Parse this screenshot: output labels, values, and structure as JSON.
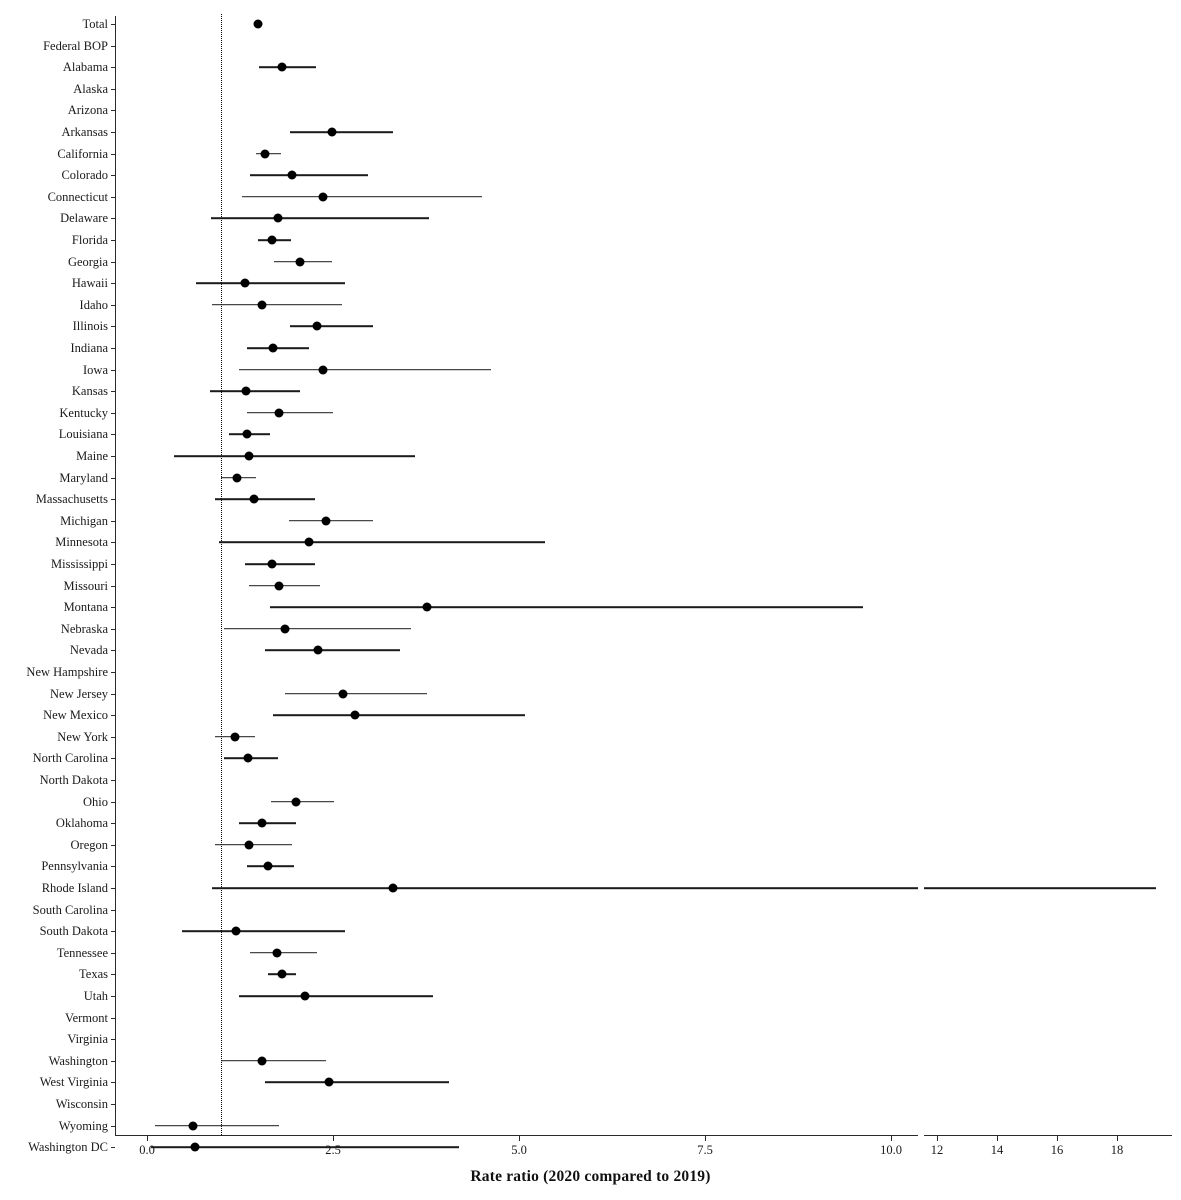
{
  "chart_data": {
    "type": "scatter",
    "subtype": "forest-plot",
    "title": "",
    "xlabel": "Rate ratio (2020 compared to 2019)",
    "ylabel": "",
    "reference_line": 1.0,
    "grid": false,
    "legend": "none",
    "axis_break": true,
    "panels": [
      {
        "name": "main",
        "xlim": [
          -0.35,
          10.4
        ],
        "ticks": [
          0.0,
          2.5,
          5.0,
          7.5,
          10.0
        ],
        "tick_labels": [
          "0.0",
          "2.5",
          "5.0",
          "7.5",
          "10.0"
        ]
      },
      {
        "name": "extended",
        "xlim": [
          11.2,
          19.4
        ],
        "ticks": [
          12,
          14,
          16,
          18
        ],
        "tick_labels": [
          "12",
          "14",
          "16",
          "18"
        ]
      }
    ],
    "categories": [
      "Total",
      "Federal BOP",
      "Alabama",
      "Alaska",
      "Arizona",
      "Arkansas",
      "California",
      "Colorado",
      "Connecticut",
      "Delaware",
      "Florida",
      "Georgia",
      "Hawaii",
      "Idaho",
      "Illinois",
      "Indiana",
      "Iowa",
      "Kansas",
      "Kentucky",
      "Louisiana",
      "Maine",
      "Maryland",
      "Massachusetts",
      "Michigan",
      "Minnesota",
      "Mississippi",
      "Missouri",
      "Montana",
      "Nebraska",
      "Nevada",
      "New Hampshire",
      "New Jersey",
      "New Mexico",
      "New York",
      "North Carolina",
      "North Dakota",
      "Ohio",
      "Oklahoma",
      "Oregon",
      "Pennsylvania",
      "Rhode Island",
      "South Carolina",
      "South Dakota",
      "Tennessee",
      "Texas",
      "Utah",
      "Vermont",
      "Virginia",
      "Washington",
      "West Virginia",
      "Wisconsin",
      "Wyoming",
      "Washington DC"
    ],
    "series_name": "Rate ratio with 95% CI",
    "points": [
      {
        "label": "Total",
        "estimate": 1.49,
        "ci_low": 1.46,
        "ci_high": 1.53
      },
      {
        "label": "Federal BOP",
        "estimate": null,
        "ci_low": null,
        "ci_high": null
      },
      {
        "label": "Alabama",
        "estimate": 1.82,
        "ci_low": 1.51,
        "ci_high": 2.27
      },
      {
        "label": "Alaska",
        "estimate": null,
        "ci_low": null,
        "ci_high": null
      },
      {
        "label": "Arizona",
        "estimate": null,
        "ci_low": null,
        "ci_high": null
      },
      {
        "label": "Arkansas",
        "estimate": 2.48,
        "ci_low": 1.92,
        "ci_high": 3.31
      },
      {
        "label": "California",
        "estimate": 1.59,
        "ci_low": 1.47,
        "ci_high": 1.8
      },
      {
        "label": "Colorado",
        "estimate": 1.95,
        "ci_low": 1.39,
        "ci_high": 2.97
      },
      {
        "label": "Connecticut",
        "estimate": 2.37,
        "ci_low": 1.28,
        "ci_high": 4.5
      },
      {
        "label": "Delaware",
        "estimate": 1.76,
        "ci_low": 0.86,
        "ci_high": 3.79
      },
      {
        "label": "Florida",
        "estimate": 1.68,
        "ci_low": 1.49,
        "ci_high": 1.93
      },
      {
        "label": "Georgia",
        "estimate": 2.05,
        "ci_low": 1.71,
        "ci_high": 2.49
      },
      {
        "label": "Hawaii",
        "estimate": 1.32,
        "ci_low": 0.66,
        "ci_high": 2.66
      },
      {
        "label": "Idaho",
        "estimate": 1.55,
        "ci_low": 0.88,
        "ci_high": 2.62
      },
      {
        "label": "Illinois",
        "estimate": 2.29,
        "ci_low": 1.92,
        "ci_high": 3.04
      },
      {
        "label": "Indiana",
        "estimate": 1.7,
        "ci_low": 1.34,
        "ci_high": 2.18
      },
      {
        "label": "Iowa",
        "estimate": 2.36,
        "ci_low": 1.24,
        "ci_high": 4.63
      },
      {
        "label": "Kansas",
        "estimate": 1.33,
        "ci_low": 0.85,
        "ci_high": 2.05
      },
      {
        "label": "Kentucky",
        "estimate": 1.78,
        "ci_low": 1.35,
        "ci_high": 2.5
      },
      {
        "label": "Louisiana",
        "estimate": 1.35,
        "ci_low": 1.1,
        "ci_high": 1.65
      },
      {
        "label": "Maine",
        "estimate": 1.37,
        "ci_low": 0.36,
        "ci_high": 3.6
      },
      {
        "label": "Maryland",
        "estimate": 1.21,
        "ci_low": 0.99,
        "ci_high": 1.47
      },
      {
        "label": "Massachusetts",
        "estimate": 1.44,
        "ci_low": 0.91,
        "ci_high": 2.26
      },
      {
        "label": "Michigan",
        "estimate": 2.41,
        "ci_low": 1.91,
        "ci_high": 3.04
      },
      {
        "label": "Minnesota",
        "estimate": 2.18,
        "ci_low": 0.97,
        "ci_high": 5.35
      },
      {
        "label": "Mississippi",
        "estimate": 1.68,
        "ci_low": 1.32,
        "ci_high": 2.26
      },
      {
        "label": "Missouri",
        "estimate": 1.77,
        "ci_low": 1.37,
        "ci_high": 2.33
      },
      {
        "label": "Montana",
        "estimate": 3.76,
        "ci_low": 1.65,
        "ci_high": 9.62
      },
      {
        "label": "Nebraska",
        "estimate": 1.85,
        "ci_low": 1.03,
        "ci_high": 3.55
      },
      {
        "label": "Nevada",
        "estimate": 2.3,
        "ci_low": 1.59,
        "ci_high": 3.4
      },
      {
        "label": "New Hampshire",
        "estimate": null,
        "ci_low": null,
        "ci_high": null
      },
      {
        "label": "New Jersey",
        "estimate": 2.63,
        "ci_low": 1.86,
        "ci_high": 3.77
      },
      {
        "label": "New Mexico",
        "estimate": 2.8,
        "ci_low": 1.7,
        "ci_high": 5.08
      },
      {
        "label": "New York",
        "estimate": 1.18,
        "ci_low": 0.92,
        "ci_high": 1.45
      },
      {
        "label": "North Carolina",
        "estimate": 1.36,
        "ci_low": 1.04,
        "ci_high": 1.76
      },
      {
        "label": "North Dakota",
        "estimate": null,
        "ci_low": null,
        "ci_high": null
      },
      {
        "label": "Ohio",
        "estimate": 2.0,
        "ci_low": 1.66,
        "ci_high": 2.52
      },
      {
        "label": "Oklahoma",
        "estimate": 1.54,
        "ci_low": 1.24,
        "ci_high": 2.0
      },
      {
        "label": "Oregon",
        "estimate": 1.37,
        "ci_low": 0.92,
        "ci_high": 1.95
      },
      {
        "label": "Pennsylvania",
        "estimate": 1.62,
        "ci_low": 1.35,
        "ci_high": 1.97
      },
      {
        "label": "Rhode Island",
        "estimate": 3.3,
        "ci_low": 0.88,
        "ci_high": 19.3
      },
      {
        "label": "South Carolina",
        "estimate": null,
        "ci_low": null,
        "ci_high": null
      },
      {
        "label": "South Dakota",
        "estimate": 1.2,
        "ci_low": 0.47,
        "ci_high": 2.66
      },
      {
        "label": "Tennessee",
        "estimate": 1.75,
        "ci_low": 1.38,
        "ci_high": 2.28
      },
      {
        "label": "Texas",
        "estimate": 1.81,
        "ci_low": 1.63,
        "ci_high": 2.0
      },
      {
        "label": "Utah",
        "estimate": 2.13,
        "ci_low": 1.23,
        "ci_high": 3.85
      },
      {
        "label": "Vermont",
        "estimate": null,
        "ci_low": null,
        "ci_high": null
      },
      {
        "label": "Virginia",
        "estimate": null,
        "ci_low": null,
        "ci_high": null
      },
      {
        "label": "Washington",
        "estimate": 1.55,
        "ci_low": 1.0,
        "ci_high": 2.4
      },
      {
        "label": "West Virginia",
        "estimate": 2.44,
        "ci_low": 1.58,
        "ci_high": 4.06
      },
      {
        "label": "Wisconsin",
        "estimate": null,
        "ci_low": null,
        "ci_high": null
      },
      {
        "label": "Wyoming",
        "estimate": 0.62,
        "ci_low": 0.11,
        "ci_high": 1.77
      },
      {
        "label": "Washington DC",
        "estimate": 0.65,
        "ci_low": 0.05,
        "ci_high": 4.2
      }
    ],
    "colors": {
      "point": "#000000",
      "ci_line": "#1b1b1b",
      "reference_line": "#000000",
      "axis": "#2b2b2b",
      "background": "#ffffff",
      "text": "#1a1a1a"
    }
  }
}
